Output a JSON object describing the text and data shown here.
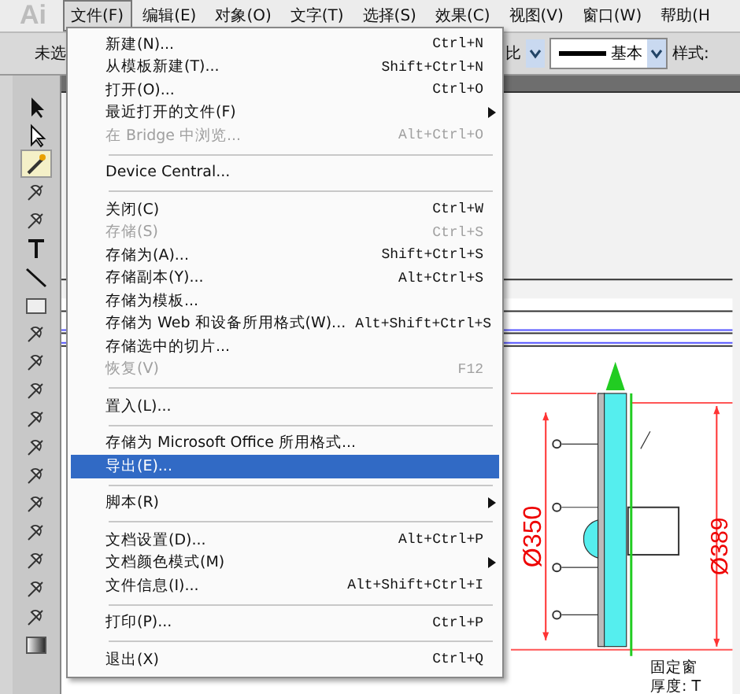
{
  "menubar": {
    "logo": "Ai",
    "items": [
      {
        "label": "文件(F)",
        "selected": true
      },
      {
        "label": "编辑(E)",
        "selected": false
      },
      {
        "label": "对象(O)",
        "selected": false
      },
      {
        "label": "文字(T)",
        "selected": false
      },
      {
        "label": "选择(S)",
        "selected": false
      },
      {
        "label": "效果(C)",
        "selected": false
      },
      {
        "label": "视图(V)",
        "selected": false
      },
      {
        "label": "窗口(W)",
        "selected": false
      },
      {
        "label": "帮助(H",
        "selected": false
      }
    ]
  },
  "control_bar": {
    "status": "未选",
    "proportion": "比",
    "stroke_style": "基本",
    "style_label": "样式:"
  },
  "file_menu": [
    {
      "kind": "item",
      "label": "新建(N)...",
      "shortcut": "Ctrl+N",
      "disabled": false,
      "selected": false,
      "submenu": false
    },
    {
      "kind": "item",
      "label": "从模板新建(T)...",
      "shortcut": "Shift+Ctrl+N",
      "disabled": false,
      "selected": false,
      "submenu": false
    },
    {
      "kind": "item",
      "label": "打开(O)...",
      "shortcut": "Ctrl+O",
      "disabled": false,
      "selected": false,
      "submenu": false
    },
    {
      "kind": "item",
      "label": "最近打开的文件(F)",
      "disabled": false,
      "selected": false,
      "submenu": true
    },
    {
      "kind": "item",
      "label": "在 Bridge 中浏览...",
      "shortcut": "Alt+Ctrl+O",
      "disabled": true,
      "selected": false,
      "submenu": false
    },
    {
      "kind": "separator"
    },
    {
      "kind": "item",
      "label": "Device Central...",
      "disabled": false,
      "selected": false,
      "submenu": false
    },
    {
      "kind": "separator"
    },
    {
      "kind": "item",
      "label": "关闭(C)",
      "shortcut": "Ctrl+W",
      "disabled": false,
      "selected": false,
      "submenu": false
    },
    {
      "kind": "item",
      "label": "存储(S)",
      "shortcut": "Ctrl+S",
      "disabled": true,
      "selected": false,
      "submenu": false
    },
    {
      "kind": "item",
      "label": "存储为(A)...",
      "shortcut": "Shift+Ctrl+S",
      "disabled": false,
      "selected": false,
      "submenu": false
    },
    {
      "kind": "item",
      "label": "存储副本(Y)...",
      "shortcut": "Alt+Ctrl+S",
      "disabled": false,
      "selected": false,
      "submenu": false
    },
    {
      "kind": "item",
      "label": "存储为模板...",
      "disabled": false,
      "selected": false,
      "submenu": false
    },
    {
      "kind": "item",
      "label": "存储为 Web 和设备所用格式(W)...",
      "shortcut": "Alt+Shift+Ctrl+S",
      "disabled": false,
      "selected": false,
      "submenu": false
    },
    {
      "kind": "item",
      "label": "存储选中的切片...",
      "disabled": false,
      "selected": false,
      "submenu": false
    },
    {
      "kind": "item",
      "label": "恢复(V)",
      "shortcut": "F12",
      "disabled": true,
      "selected": false,
      "submenu": false
    },
    {
      "kind": "separator"
    },
    {
      "kind": "item",
      "label": "置入(L)...",
      "disabled": false,
      "selected": false,
      "submenu": false
    },
    {
      "kind": "separator"
    },
    {
      "kind": "item",
      "label": "存储为 Microsoft Office 所用格式...",
      "disabled": false,
      "selected": false,
      "submenu": false
    },
    {
      "kind": "item",
      "label": "导出(E)...",
      "disabled": false,
      "selected": true,
      "submenu": false
    },
    {
      "kind": "separator"
    },
    {
      "kind": "item",
      "label": "脚本(R)",
      "disabled": false,
      "selected": false,
      "submenu": true
    },
    {
      "kind": "separator"
    },
    {
      "kind": "item",
      "label": "文档设置(D)...",
      "shortcut": "Alt+Ctrl+P",
      "disabled": false,
      "selected": false,
      "submenu": false
    },
    {
      "kind": "item",
      "label": "文档颜色模式(M)",
      "disabled": false,
      "selected": false,
      "submenu": true
    },
    {
      "kind": "item",
      "label": "文件信息(I)...",
      "shortcut": "Alt+Shift+Ctrl+I",
      "disabled": false,
      "selected": false,
      "submenu": false
    },
    {
      "kind": "separator"
    },
    {
      "kind": "item",
      "label": "打印(P)...",
      "shortcut": "Ctrl+P",
      "disabled": false,
      "selected": false,
      "submenu": false
    },
    {
      "kind": "separator"
    },
    {
      "kind": "item",
      "label": "退出(X)",
      "shortcut": "Ctrl+Q",
      "disabled": false,
      "selected": false,
      "submenu": false
    }
  ],
  "drawing": {
    "dimension_left": "Ø350",
    "dimension_right": "Ø389",
    "note_1": "固定窗",
    "note_2": "厚度: T"
  }
}
